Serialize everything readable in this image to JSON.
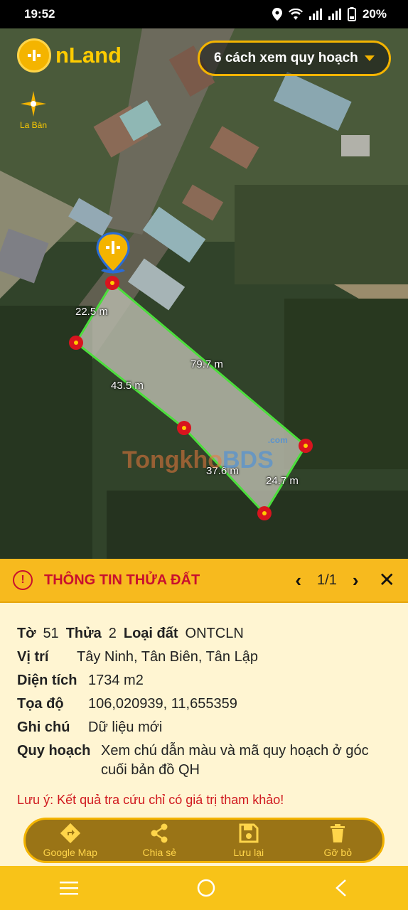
{
  "status": {
    "time": "19:52",
    "battery": "20%"
  },
  "app": {
    "logo_text": "nLand",
    "compass_label": "La Bàn"
  },
  "plan_view": {
    "label": "6 cách xem quy hoạch"
  },
  "map": {
    "edge_labels": [
      "22.5 m",
      "79.7 m",
      "43.5 m",
      "37.6 m",
      "24.7 m"
    ],
    "watermark": {
      "part1": "Tongkho",
      "part2": "BDS",
      "suffix": ".com"
    }
  },
  "panel": {
    "title": "THÔNG TIN THỬA ĐẤT",
    "pager": "1/1",
    "to_label": "Tờ",
    "to_value": "51",
    "thua_label": "Thửa",
    "thua_value": "2",
    "loai_label": "Loại đất",
    "loai_value": "ONTCLN",
    "vitri_label": "Vị trí",
    "vitri_value": "Tây Ninh, Tân Biên, Tân Lập",
    "dientich_label": "Diện tích",
    "dientich_value": "1734 m2",
    "toado_label": "Tọa độ",
    "toado_value": "106,020939, 11,655359",
    "ghichu_label": "Ghi chú",
    "ghichu_value": "Dữ liệu mới",
    "quyhoach_label": "Quy hoạch",
    "quyhoach_value": "Xem chú dẫn màu và mã quy hoạch ở góc cuối bản đồ QH",
    "note": "Lưu ý: Kết quả tra cứu chỉ có giá trị tham khảo!"
  },
  "actions": {
    "google_map": "Google Map",
    "share": "Chia sẻ",
    "save": "Lưu lại",
    "remove": "Gỡ bỏ"
  },
  "colors": {
    "accent": "#f4b400",
    "title_red": "#c8102e",
    "parcel_edge": "#4cde3c"
  }
}
